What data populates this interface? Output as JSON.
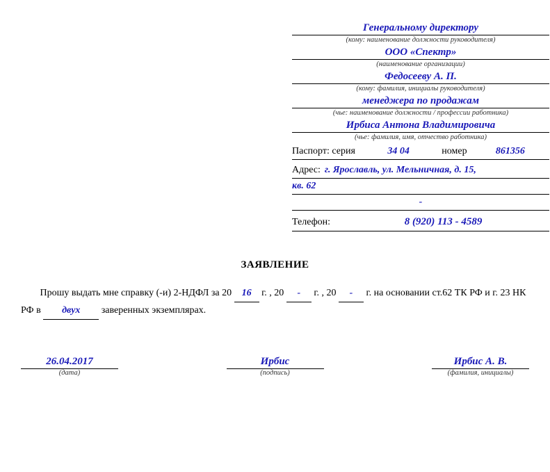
{
  "header": {
    "to_position": "Генеральному директору",
    "to_position_caption": "(кому: наименование должности руководителя)",
    "org_name": "ООО «Спектр»",
    "org_name_caption": "(наименование организации)",
    "to_person": "Федосееву А. П.",
    "to_person_caption": "(кому: фамилия, инициалы руководителя)",
    "from_position": "менеджера по продажам",
    "from_position_caption": "(чье: наименование должности / профессии работника)",
    "from_person": "Ирбиса Антона Владимировича",
    "from_person_caption": "(чье: фамилия, имя, отчество работника)",
    "passport_label": "Паспорт: серия",
    "passport_series": "34 04",
    "passport_number_label": "номер",
    "passport_number": "861356",
    "address_label": "Адрес:",
    "address_line1": "г. Ярославль, ул. Мельничная, д. 15,",
    "address_line2": "кв. 62",
    "address_line3": "-",
    "phone_label": "Телефон:",
    "phone": "8 (920) 113 - 4589"
  },
  "title": "ЗАЯВЛЕНИЕ",
  "body": {
    "prefix": "Прошу выдать мне справку (-и) 2-НДФЛ за 20",
    "year1": "16",
    "after_year1": "г. , 20",
    "year2": "-",
    "after_year2": "г. , 20",
    "year3": "-",
    "after_year3": "г.  на основании ст.62 ТК РФ и г. 23 НК РФ в",
    "copies": "двух",
    "suffix": "заверенных экземплярах."
  },
  "signatures": {
    "date_value": "26.04.2017",
    "date_caption": "(дата)",
    "sign_value": "Ирбис",
    "sign_caption": "(подпись)",
    "name_value": "Ирбис А. В.",
    "name_caption": "(фамилия, инициалы)"
  }
}
